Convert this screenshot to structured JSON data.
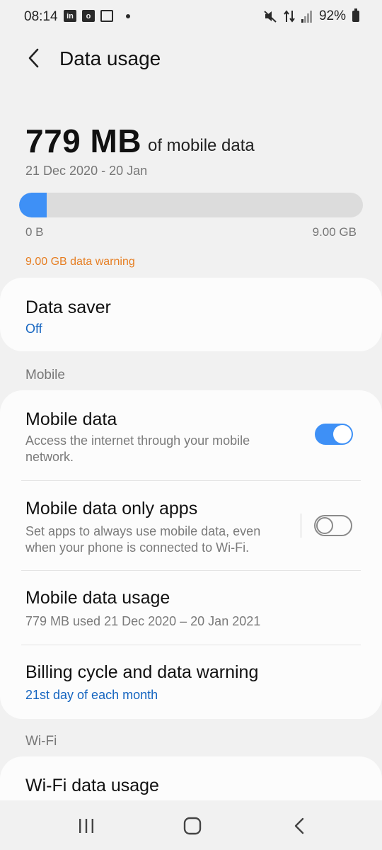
{
  "status_bar": {
    "time": "08:14",
    "icons": [
      "linkedin-icon",
      "outlook-icon",
      "calendar-icon",
      "notification-dot"
    ],
    "battery": "92%"
  },
  "header": {
    "title": "Data usage"
  },
  "usage": {
    "amount": "779 MB",
    "suffix": "of mobile data",
    "period": "21 Dec 2020 - 20 Jan",
    "progress_fraction": 0.081,
    "min_label": "0 B",
    "max_label": "9.00 GB",
    "warning": "9.00 GB data warning",
    "accent": "#3e90f6",
    "warning_color": "#e67e22"
  },
  "data_saver": {
    "title": "Data saver",
    "status": "Off"
  },
  "mobile_section": {
    "label": "Mobile",
    "mobile_data": {
      "title": "Mobile data",
      "desc_line1": "Access the internet through your mobile",
      "desc_line2": "network.",
      "enabled": true
    },
    "mobile_only_apps": {
      "title": "Mobile data only apps",
      "desc_line1": "Set apps to always use mobile data, even",
      "desc_line2": "when your phone is connected to Wi-Fi.",
      "enabled": false
    },
    "usage": {
      "title": "Mobile data usage",
      "desc": "779 MB used 21 Dec 2020 – 20 Jan 2021"
    },
    "billing": {
      "title": "Billing cycle and data warning",
      "desc": "21st day of each month"
    }
  },
  "wifi_section": {
    "label": "Wi-Fi",
    "usage": {
      "title": "Wi-Fi data usage"
    }
  },
  "nav": {
    "recents": "recents-icon",
    "home": "home-icon",
    "back": "back-icon"
  }
}
